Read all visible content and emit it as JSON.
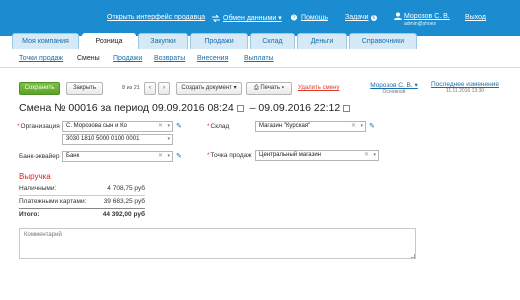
{
  "topbar": {
    "open_interface": "Открыть интерфейс продавца",
    "exchange": "Обмен данными",
    "help": "Помощь",
    "tasks": "Задачи",
    "tasks_count": "6",
    "user_name": "Морозов С. В.",
    "user_login": "admin@shoes",
    "logout": "Выход"
  },
  "tabs": [
    "Моя компания",
    "Розница",
    "Закупки",
    "Продажи",
    "Склад",
    "Деньги",
    "Справочники"
  ],
  "subnav": [
    "Точки продаж",
    "Смены",
    "Продажи",
    "Возвраты",
    "Внесения",
    "Выплаты"
  ],
  "toolbar": {
    "save": "Сохранить",
    "close": "Закрыть",
    "pager": "8 из 21",
    "create_doc": "Создать документ",
    "print": "Печать",
    "delete": "Удалить смену",
    "author_name": "Морозов С. В.",
    "author_sub": "Основной",
    "last_change_label": "Последнее изменение",
    "last_change_date": "11.11.2016 13:30"
  },
  "title": {
    "prefix": "Смена №",
    "number": "00016",
    "period_label": "за период",
    "from": "09.09.2016 08:24",
    "dash": "–",
    "to": "09.09.2016 22:12"
  },
  "form": {
    "org_label": "Организация",
    "org_value": "С. Морозова сын и Ко",
    "account_value": "3030 1810 5000 0100 0001",
    "bank_label": "Банк-эквайер",
    "bank_value": "Банк",
    "store_label": "Склад",
    "store_value": "Магазин \"Курская\"",
    "point_label": "Точка продаж",
    "point_value": "Центральный магазин"
  },
  "revenue": {
    "title": "Выручка",
    "cash_label": "Наличными:",
    "cash_value": "4 708,75 руб",
    "card_label": "Платежными картами:",
    "card_value": "39 683,25 руб",
    "total_label": "Итого:",
    "total_value": "44 392,00 руб"
  },
  "comment_placeholder": "Комментарий",
  "colors": {
    "topbar": "#1a8ccf",
    "accent_red": "#d9261c",
    "save_green": "#5aa229"
  }
}
